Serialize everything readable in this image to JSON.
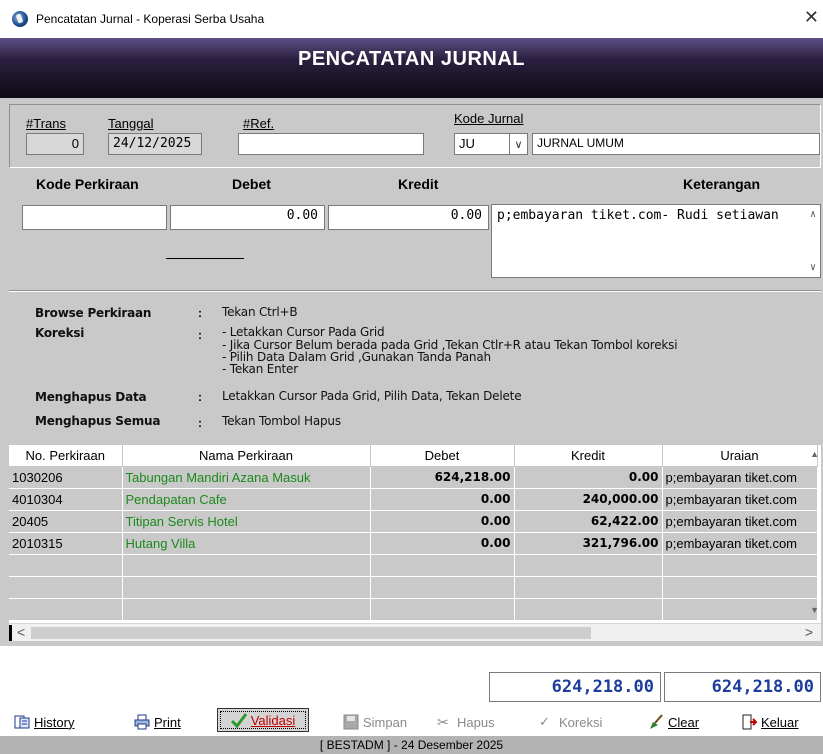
{
  "window": {
    "title": "Pencatatan Jurnal - Koperasi Serba Usaha",
    "close_glyph": "✕"
  },
  "banner": {
    "title": "PENCATATAN JURNAL"
  },
  "header": {
    "trans_label": "#Trans",
    "trans_value": "0",
    "tanggal_label": "Tanggal",
    "tanggal_value": "24/12/2025",
    "ref_label": "#Ref.",
    "ref_value": "",
    "kode_jurnal_label": "Kode Jurnal",
    "kode_jurnal_code": "JU",
    "kode_jurnal_name": "JURNAL UMUM"
  },
  "entry": {
    "col_kode": "Kode Perkiraan",
    "col_debet": "Debet",
    "col_kredit": "Kredit",
    "col_keterangan": "Keterangan",
    "kode_value": "",
    "debet_value": "0.00",
    "kredit_value": "0.00",
    "keterangan_value": "p;embayaran tiket.com- Rudi setiawan"
  },
  "help": {
    "browse_label": "Browse Perkiraan",
    "browse_text": "Tekan Ctrl+B",
    "koreksi_label": "Koreksi",
    "koreksi_lines": [
      "- Letakkan Cursor Pada Grid",
      "- Jika Cursor Belum berada pada Grid ,Tekan Ctlr+R atau Tekan Tombol koreksi",
      "- Pilih Data Dalam Grid ,Gunakan Tanda Panah",
      "- Tekan Enter"
    ],
    "hapus_label": "Menghapus Data",
    "hapus_text": "Letakkan Cursor Pada Grid, Pilih Data, Tekan Delete",
    "hapus_semua_label": "Menghapus Semua",
    "hapus_semua_text": "Tekan Tombol Hapus",
    "colon": ":"
  },
  "grid": {
    "headers": [
      "No. Perkiraan",
      "Nama Perkiraan",
      "Debet",
      "Kredit",
      "Uraian"
    ],
    "rows": [
      {
        "no": "1030206",
        "nama": "Tabungan Mandiri Azana Masuk",
        "debet": "624,218.00",
        "kredit": "0.00",
        "uraian": "p;embayaran tiket.com"
      },
      {
        "no": "4010304",
        "nama": "Pendapatan Cafe",
        "debet": "0.00",
        "kredit": "240,000.00",
        "uraian": "p;embayaran tiket.com"
      },
      {
        "no": "20405",
        "nama": "Titipan Servis Hotel",
        "debet": "0.00",
        "kredit": "62,422.00",
        "uraian": "p;embayaran tiket.com"
      },
      {
        "no": "2010315",
        "nama": "Hutang Villa",
        "debet": "0.00",
        "kredit": "321,796.00",
        "uraian": "p;embayaran tiket.com"
      }
    ]
  },
  "totals": {
    "debet": "624,218.00",
    "kredit": "624,218.00"
  },
  "buttons": {
    "history": "History",
    "print": "Print",
    "validasi": "Validasi",
    "simpan": "Simpan",
    "hapus": "Hapus",
    "koreksi": "Koreksi",
    "clear": "Clear",
    "keluar": "Keluar"
  },
  "status": {
    "text": "[ BESTADM ] - 24 Desember 2025"
  },
  "colors": {
    "accent_total": "#1e3c9c",
    "grid_name": "#1a8a1a",
    "validasi_text": "#c00000",
    "panel": "#c9c9c9"
  },
  "icons": [
    "app-globe-icon",
    "close-icon",
    "dropdown-arrow-icon",
    "history-icon",
    "print-icon",
    "check-icon",
    "save-icon",
    "scissors-icon",
    "spellcheck-icon",
    "broom-icon",
    "exit-door-icon"
  ]
}
